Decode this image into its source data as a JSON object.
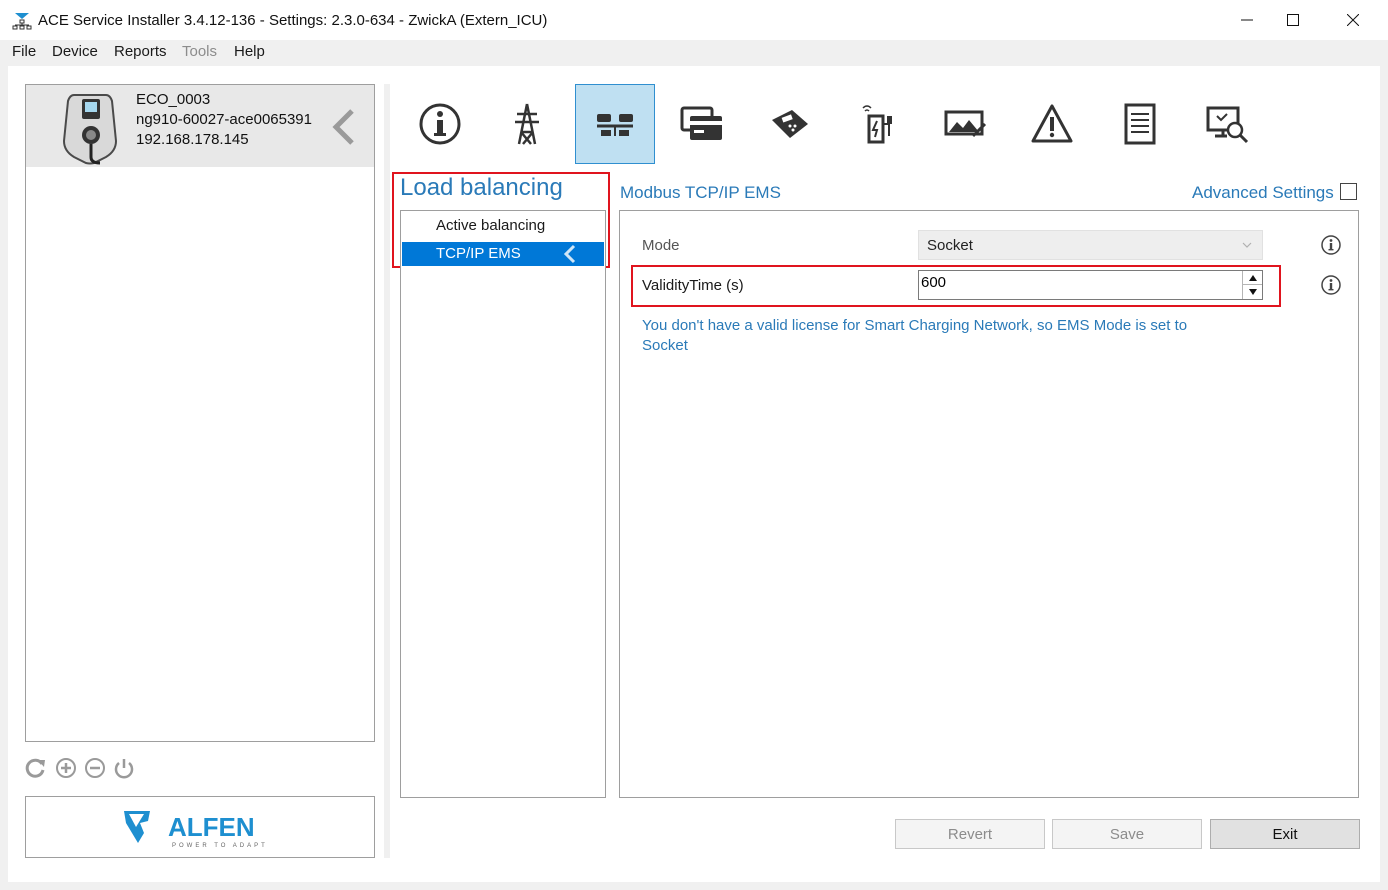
{
  "window": {
    "title": "ACE Service Installer 3.4.12-136 - Settings: 2.3.0-634 - ZwickA (Extern_ICU)"
  },
  "menu": {
    "items": [
      {
        "label": "File",
        "enabled": true
      },
      {
        "label": "Device",
        "enabled": true
      },
      {
        "label": "Reports",
        "enabled": true
      },
      {
        "label": "Tools",
        "enabled": false
      },
      {
        "label": "Help",
        "enabled": true
      }
    ]
  },
  "device": {
    "name": "ECO_0003",
    "serial": "ng910-60027-ace0065391",
    "ip": "192.168.178.145"
  },
  "device_tools": [
    "refresh-icon",
    "add-icon",
    "remove-icon",
    "power-icon"
  ],
  "logo": {
    "text": "ALFEN",
    "tagline": "POWER TO ADAPT"
  },
  "nav_icons": [
    "info-icon",
    "power-grid-icon",
    "load-balancing-icon",
    "card-icon",
    "payment-terminal-icon",
    "charging-station-icon",
    "display-icon",
    "warning-icon",
    "log-icon",
    "diagnostics-icon"
  ],
  "section": {
    "title": "Load balancing",
    "items": [
      {
        "label": "Active balancing",
        "selected": false
      },
      {
        "label": "TCP/IP EMS",
        "selected": true
      }
    ]
  },
  "panel": {
    "title": "Modbus TCP/IP EMS",
    "advanced_label": "Advanced Settings",
    "mode_label": "Mode",
    "mode_value": "Socket",
    "validity_label": "ValidityTime (s)",
    "validity_value": "600",
    "license_message": "You don't have a valid license for Smart Charging Network, so EMS Mode is set to Socket"
  },
  "buttons": {
    "revert": "Revert",
    "save": "Save",
    "exit": "Exit"
  },
  "colors": {
    "accent": "#2a7ab8",
    "selection": "#0078d7",
    "highlight_box": "#e0141e",
    "active_tab": "#bfe0f2"
  }
}
